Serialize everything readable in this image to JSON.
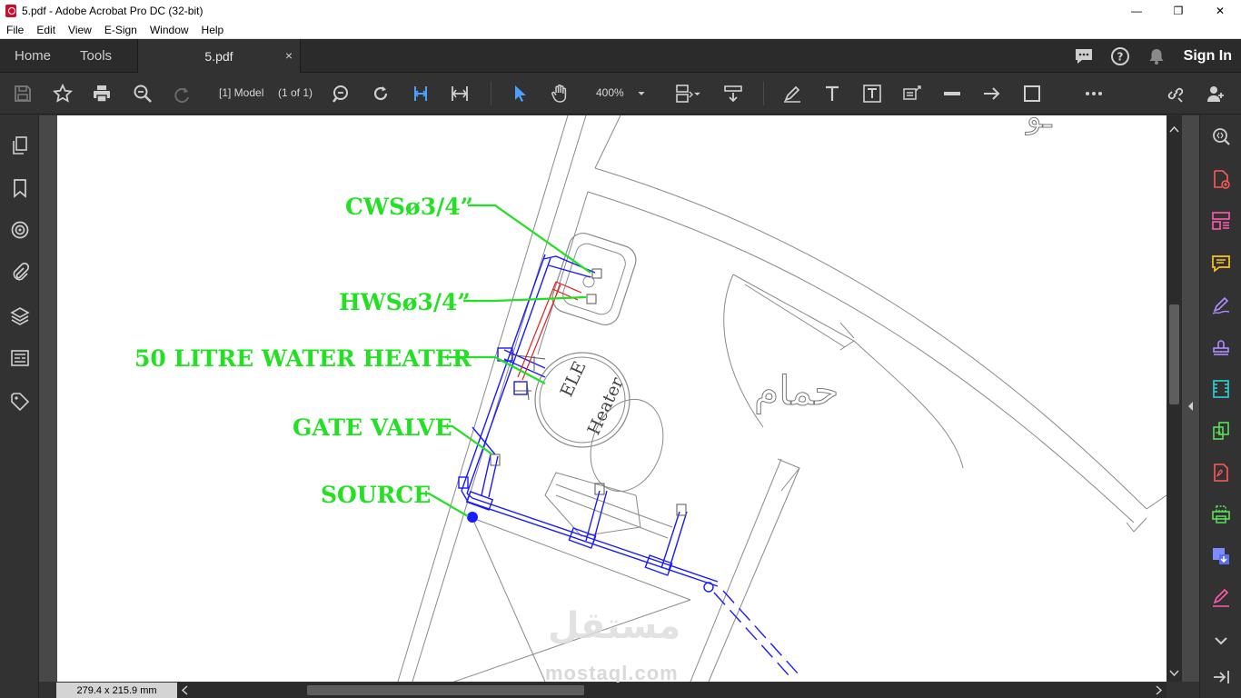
{
  "window": {
    "title": "5.pdf - Adobe Acrobat Pro DC (32-bit)",
    "minimize": "—",
    "restore": "❐",
    "close": "✕"
  },
  "menu": [
    "File",
    "Edit",
    "View",
    "E-Sign",
    "Window",
    "Help"
  ],
  "tabs": {
    "home": "Home",
    "tools": "Tools",
    "document": "5.pdf",
    "close": "×",
    "sign_in": "Sign In"
  },
  "toolbar": {
    "page_label": "[1] Model",
    "page_count": "(1 of 1)",
    "zoom": "400%"
  },
  "status": {
    "page_size": "279.4 x 215.9 mm"
  },
  "drawing": {
    "labels": {
      "cws": "CWSø3/4”",
      "hws": "HWSø3/4”",
      "heater": "50 LITRE WATER HEATER",
      "gate_valve": "GATE VALVE",
      "source": "SOURCE"
    },
    "heater_text": [
      "ELE",
      "Heater"
    ],
    "room_label": "حمام",
    "watermark_ar": "مستقل",
    "watermark": "mostaql.com"
  },
  "colors": {
    "label_green": "#22e022",
    "pipe_blue": "#1a1aff",
    "pipe_red": "#e02020",
    "ui_dark": "#323232"
  }
}
